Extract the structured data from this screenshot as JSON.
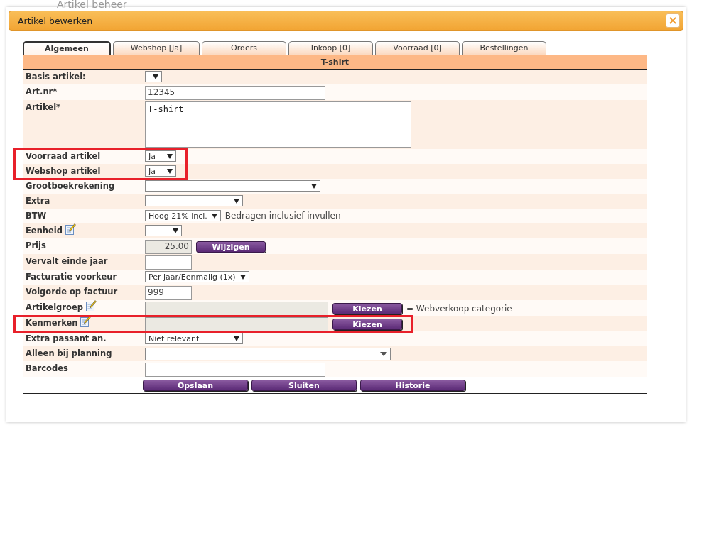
{
  "background_page": {
    "title": "Artikel beheer"
  },
  "dialog": {
    "title": "Artikel bewerken",
    "close_label": "×"
  },
  "tabs": [
    {
      "label": "Algemeen",
      "selected": true
    },
    {
      "label": "Webshop [Ja]",
      "selected": false
    },
    {
      "label": "Orders",
      "selected": false
    },
    {
      "label": "Inkoop [0]",
      "selected": false
    },
    {
      "label": "Voorraad [0]",
      "selected": false
    },
    {
      "label": "Bestellingen",
      "selected": false
    }
  ],
  "form": {
    "title": "T-shirt",
    "rows": [
      {
        "label": "Basis artikel:",
        "kind": "select"
      },
      {
        "label": "Art.nr*",
        "kind": "text",
        "value": "12345"
      },
      {
        "label": "Artikel*",
        "kind": "textarea",
        "value": "T-shirt"
      },
      {
        "label": "Voorraad artikel",
        "kind": "select",
        "value": "Ja",
        "highlighted": true
      },
      {
        "label": "Webshop artikel",
        "kind": "select",
        "value": "Ja",
        "highlighted": true
      },
      {
        "label": "Grootboekrekening",
        "kind": "select"
      },
      {
        "label": "Extra",
        "kind": "select"
      },
      {
        "label": "BTW",
        "kind": "select",
        "value": "Hoog 21% incl.",
        "note": "Bedragen inclusief invullen"
      },
      {
        "label": "Eenheid",
        "kind": "select",
        "editable": true
      },
      {
        "label": "Prijs",
        "kind": "readonly",
        "value": "25.00",
        "button": "Wijzigen"
      },
      {
        "label": "Vervalt einde jaar",
        "kind": "text"
      },
      {
        "label": "Facturatie voorkeur",
        "kind": "select",
        "value": "Per jaar/Eenmalig (1x)"
      },
      {
        "label": "Volgorde op factuur",
        "kind": "text",
        "value": "999"
      },
      {
        "label": "Artikelgroep",
        "kind": "readonly",
        "editable": true,
        "button": "Kiezen",
        "note": "= Webverkoop categorie"
      },
      {
        "label": "Kenmerken",
        "kind": "readonly",
        "editable": true,
        "button": "Kiezen",
        "highlighted": true
      },
      {
        "label": "Extra passant an.",
        "kind": "select",
        "value": "Niet relevant"
      },
      {
        "label": "Alleen bij planning",
        "kind": "combo"
      },
      {
        "label": "Barcodes",
        "kind": "text"
      }
    ],
    "buttons": [
      "Opslaan",
      "Sluiten",
      "Historie"
    ]
  }
}
